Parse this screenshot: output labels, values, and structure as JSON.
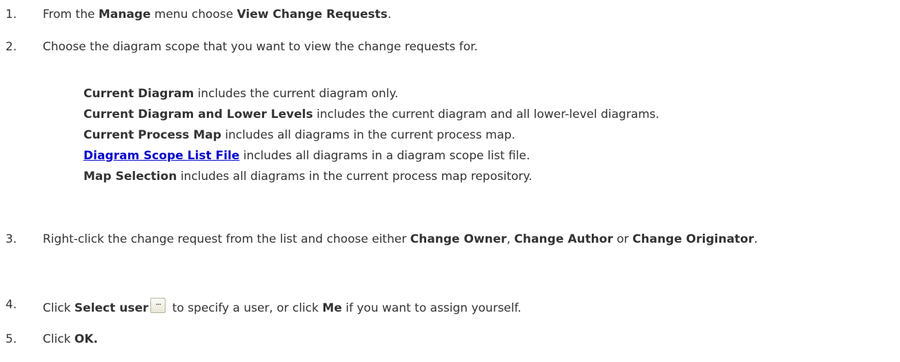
{
  "steps": [
    {
      "number": "1.",
      "parts": [
        "From the ",
        "Manage",
        " menu choose ",
        "View Change Requests",
        "."
      ]
    },
    {
      "number": "2.",
      "text": "Choose the diagram scope that you want to view the change requests for.",
      "scopes": [
        {
          "term": "Current Diagram",
          "desc": " includes the current diagram only.",
          "link": false
        },
        {
          "term": "Current Diagram and Lower Levels",
          "desc": " includes the current diagram and all lower-level diagrams.",
          "link": false
        },
        {
          "term": "Current Process Map",
          "desc": " includes all diagrams in the current process map.",
          "link": false
        },
        {
          "term": "Diagram Scope List File",
          "desc": " includes all diagrams in a diagram scope list file.",
          "link": true
        },
        {
          "term": "Map Selection",
          "desc": " includes all diagrams in the current process map repository.",
          "link": false
        }
      ]
    },
    {
      "number": "3.",
      "parts": [
        "Right-click the change request from the list and choose either ",
        "Change Owner",
        ", ",
        "Change Author",
        " or ",
        "Change Originator",
        "."
      ]
    },
    {
      "number": "4.",
      "parts": [
        "Click ",
        "Select user",
        " to specify a user, or click ",
        "Me",
        " if you want to assign yourself."
      ],
      "icon": {
        "name": "ellipsis-button-icon",
        "glyph": "..."
      }
    },
    {
      "number": "5.",
      "parts": [
        "Click ",
        "OK."
      ]
    }
  ]
}
